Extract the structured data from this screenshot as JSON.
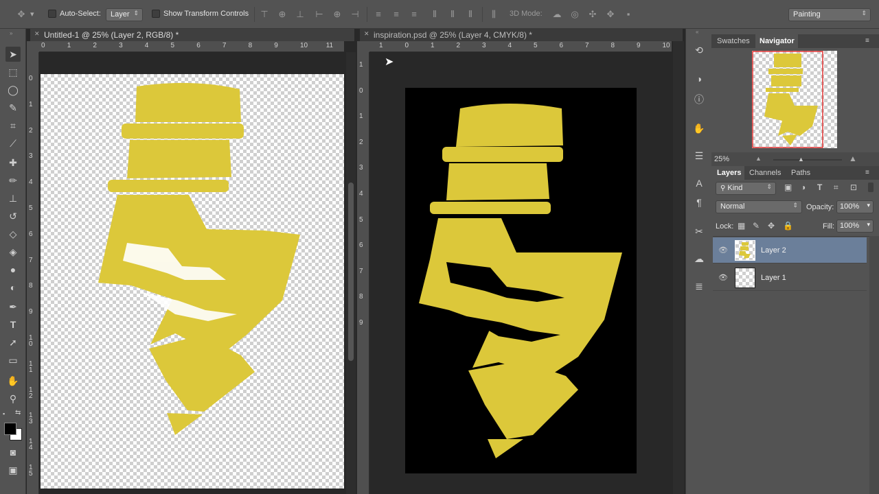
{
  "options_bar": {
    "auto_select_label": "Auto-Select:",
    "auto_select_value": "Layer",
    "show_transform_label": "Show Transform Controls",
    "mode_3d_label": "3D Mode:",
    "workspace_value": "Painting"
  },
  "documents": [
    {
      "tab_title": "Untitled-1 @ 25% (Layer 2, RGB/8) *"
    },
    {
      "tab_title": "inspiration.psd @ 25% (Layer 4, CMYK/8) *"
    }
  ],
  "ruler_left": {
    "h": [
      "0",
      "1",
      "2",
      "3",
      "4",
      "5",
      "6",
      "7",
      "8",
      "9",
      "10",
      "11"
    ],
    "v": [
      "0",
      "1",
      "2",
      "3",
      "4",
      "5",
      "6",
      "7",
      "8",
      "9",
      "1 0",
      "1 1",
      "1 2",
      "1 3",
      "1 4",
      "1 5"
    ]
  },
  "ruler_right": {
    "h": [
      "1",
      "0",
      "1",
      "2",
      "3",
      "4",
      "5",
      "6",
      "7",
      "8",
      "9",
      "10"
    ],
    "v": [
      "1",
      "0",
      "1",
      "2",
      "3",
      "4",
      "5",
      "6",
      "7",
      "8",
      "9"
    ]
  },
  "navigator": {
    "tabs": [
      "Swatches",
      "Navigator"
    ],
    "zoom": "25%"
  },
  "layers_panel": {
    "tabs": [
      "Layers",
      "Channels",
      "Paths"
    ],
    "filter_kind": "Kind",
    "blend_mode": "Normal",
    "opacity_label": "Opacity:",
    "opacity_value": "100%",
    "lock_label": "Lock:",
    "fill_label": "Fill:",
    "fill_value": "100%",
    "layers": [
      {
        "name": "Layer 2",
        "selected": true
      },
      {
        "name": "Layer 1",
        "selected": false
      }
    ]
  },
  "colors": {
    "artwork_yellow": "#dcc83a",
    "selected_layer": "#6b7f9a",
    "ui_gray": "#535353"
  },
  "icons": [
    "move-tool-icon",
    "marquee-tool-icon",
    "lasso-tool-icon",
    "quick-select-icon",
    "crop-tool-icon",
    "eyedropper-icon",
    "healing-brush-icon",
    "brush-tool-icon",
    "clone-stamp-icon",
    "history-brush-icon",
    "eraser-icon",
    "paint-bucket-icon",
    "blur-tool-icon",
    "dodge-tool-icon",
    "pen-tool-icon",
    "type-tool-icon",
    "path-select-icon",
    "rectangle-tool-icon",
    "hand-tool-icon",
    "zoom-tool-icon",
    "eye-icon"
  ]
}
